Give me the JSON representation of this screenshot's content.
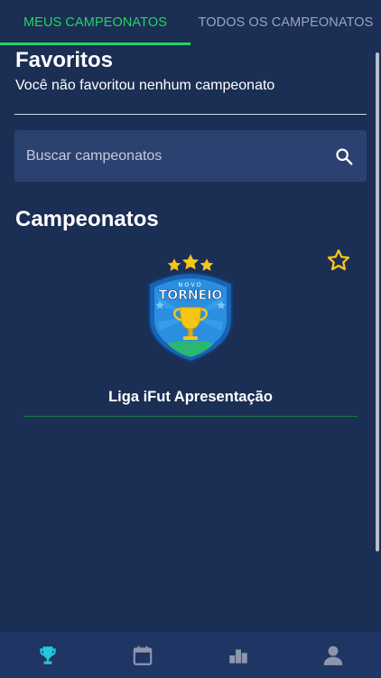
{
  "tabs": [
    {
      "label": "MEUS CAMPEONATOS",
      "active": true
    },
    {
      "label": "TODOS OS CAMPEONATOS",
      "active": false
    }
  ],
  "favorites": {
    "title": "Favoritos",
    "empty_message": "Você não favoritou nenhum campeonato"
  },
  "search": {
    "placeholder": "Buscar campeonatos",
    "icon": "search-icon"
  },
  "championships": {
    "title": "Campeonatos",
    "items": [
      {
        "name": "Liga iFut Apresentação",
        "logo_text_top": "NOVO",
        "logo_text_main": "TORNEIO",
        "favorite": false
      }
    ]
  },
  "bottom_nav": [
    {
      "icon": "trophy-icon",
      "active": true
    },
    {
      "icon": "calendar-icon",
      "active": false
    },
    {
      "icon": "ranking-icon",
      "active": false
    },
    {
      "icon": "profile-icon",
      "active": false
    }
  ],
  "colors": {
    "background": "#1b2e54",
    "accent": "#1ed760",
    "active_nav": "#26c6da",
    "inactive_nav": "#8d97ab",
    "star": "#f5c518"
  }
}
